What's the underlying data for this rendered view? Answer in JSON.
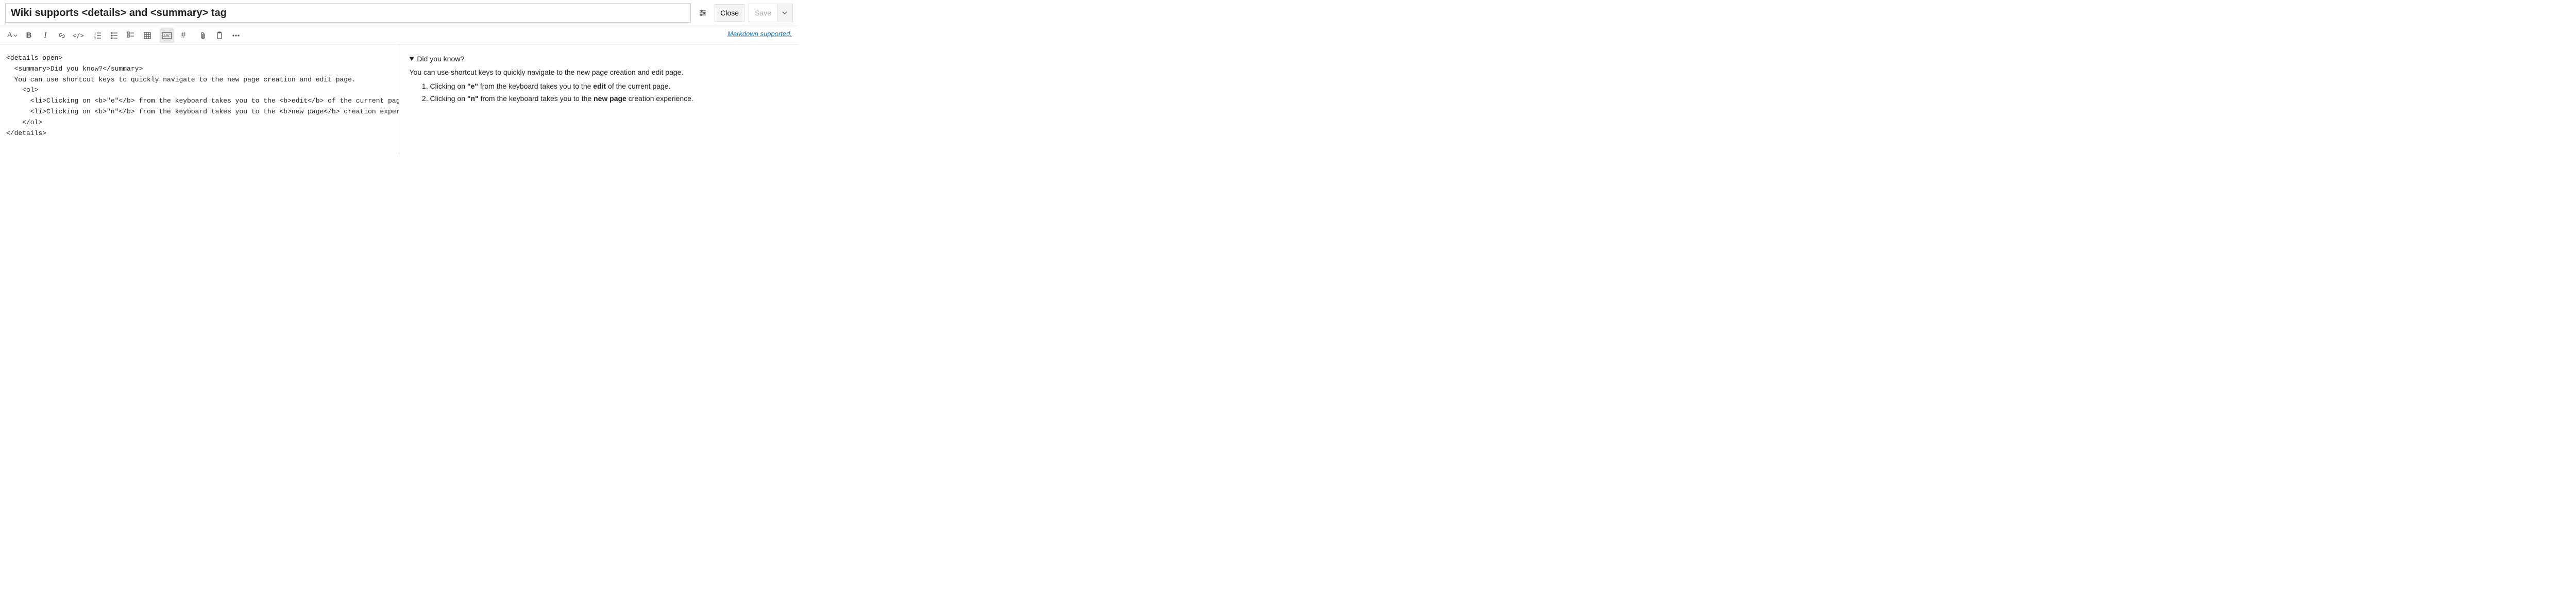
{
  "header": {
    "title_value": "Wiki supports <details> and <summary> tag",
    "close_label": "Close",
    "save_label": "Save"
  },
  "toolbar": {
    "markdown_link": "Markdown supported."
  },
  "editor": {
    "source": "<details open>\n  <summary>Did you know?</summary>\n  You can use shortcut keys to quickly navigate to the new page creation and edit page.\n    <ol>\n      <li>Clicking on <b>\"e\"</b> from the keyboard takes you to the <b>edit</b> of the current page.</li>\n      <li>Clicking on <b>\"n\"</b> from the keyboard takes you to the <b>new page</b> creation experience.</li>\n    </ol>\n</details>"
  },
  "preview": {
    "summary": "Did you know?",
    "intro": "You can use shortcut keys to quickly navigate to the new page creation and edit page.",
    "items": [
      {
        "pre": "Clicking on ",
        "key": "\"e\"",
        "mid": " from the keyboard takes you to the ",
        "bold": "edit",
        "post": " of the current page."
      },
      {
        "pre": "Clicking on ",
        "key": "\"n\"",
        "mid": " from the keyboard takes you to the ",
        "bold": "new page",
        "post": " creation experience."
      }
    ]
  }
}
